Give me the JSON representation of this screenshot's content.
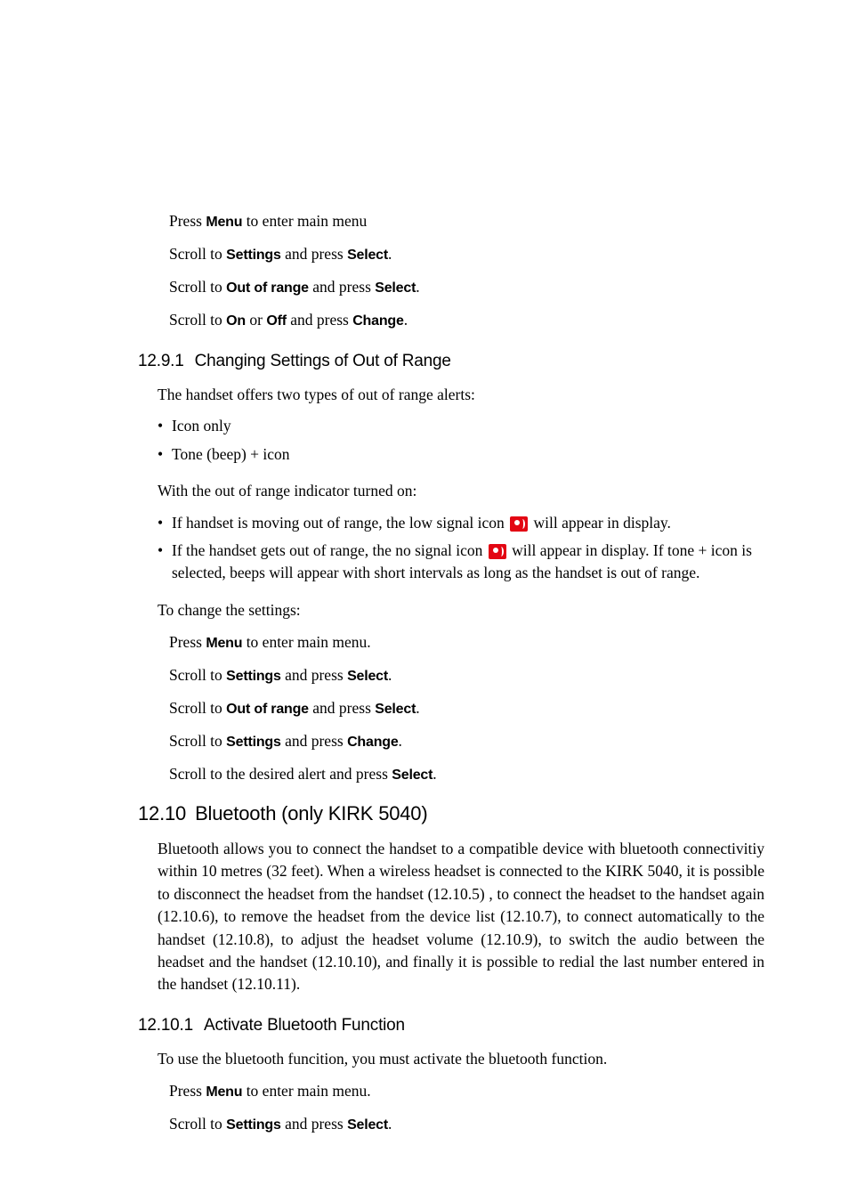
{
  "steps1": {
    "a": {
      "pre": "Press ",
      "kw": "Menu",
      "post": " to enter main menu"
    },
    "b": {
      "pre": "Scroll to ",
      "kw": "Settings",
      "mid": " and press ",
      "kw2": "Select",
      "post": "."
    },
    "c": {
      "pre": "Scroll to ",
      "kw": "Out of range",
      "mid": " and press ",
      "kw2": "Select",
      "post": "."
    },
    "d": {
      "pre": "Scroll to ",
      "kw": "On",
      "mid": " or ",
      "kw2": "Off",
      "mid2": " and press ",
      "kw3": "Change",
      "post": "."
    }
  },
  "h1291": {
    "num": "12.9.1",
    "title": "Changing Settings of Out of Range"
  },
  "p1": "The handset offers two types of out of range alerts:",
  "bul1": {
    "a": "Icon only",
    "b": "Tone (beep) + icon"
  },
  "p2": "With the out of range indicator turned on:",
  "bul2": {
    "a": {
      "pre": "If handset is moving out of range, the low signal icon ",
      "post": " will appear in display."
    },
    "b": {
      "pre": "If the handset gets out of range, the no signal icon ",
      "post": " will appear in display. If tone + icon is selected, beeps will appear with short intervals as long as the handset is out of range."
    }
  },
  "p3": "To change the settings:",
  "steps2": {
    "a": {
      "pre": "Press ",
      "kw": "Menu",
      "post": " to enter main menu."
    },
    "b": {
      "pre": "Scroll to ",
      "kw": "Settings",
      "mid": " and press ",
      "kw2": "Select",
      "post": "."
    },
    "c": {
      "pre": "Scroll to ",
      "kw": "Out of range",
      "mid": " and press ",
      "kw2": "Select",
      "post": "."
    },
    "d": {
      "pre": "Scroll to ",
      "kw": "Settings",
      "mid": " and press ",
      "kw2": "Change",
      "post": "."
    },
    "e": {
      "pre": "Scroll to the desired alert and press ",
      "kw": "Select",
      "post": "."
    }
  },
  "h1210": {
    "num": "12.10",
    "title": "Bluetooth (only KIRK 5040)"
  },
  "p4": "Bluetooth allows you to connect the handset to a compatible device with bluetooth connectivitiy within 10 metres (32 feet). When a wireless headset is connected to the KIRK 5040, it is possible to disconnect the headset from the handset (12.10.5) , to connect the headset to the handset again (12.10.6), to remove the headset from the device list (12.10.7), to connect automatically to the handset (12.10.8), to adjust the headset volume (12.10.9), to switch the audio between the headset and the handset (12.10.10), and finally it is possible to redial the last number entered in the handset (12.10.11).",
  "h12101": {
    "num": "12.10.1",
    "title": "Activate Bluetooth Function"
  },
  "p5": "To use the bluetooth funcition, you must activate the bluetooth function.",
  "steps3": {
    "a": {
      "pre": "Press ",
      "kw": "Menu",
      "post": " to enter main menu."
    },
    "b": {
      "pre": "Scroll to ",
      "kw": "Settings",
      "mid": " and press ",
      "kw2": "Select",
      "post": "."
    }
  }
}
